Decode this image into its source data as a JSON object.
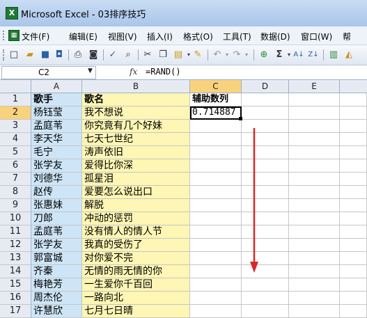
{
  "window": {
    "title": "Microsoft Excel - 03排序技巧",
    "app_icon_glyph": "X"
  },
  "menu": {
    "items": [
      "文件(F)",
      "编辑(E)",
      "视图(V)",
      "插入(I)",
      "格式(O)",
      "工具(T)",
      "数据(D)",
      "窗口(W)",
      "帮"
    ]
  },
  "formula_bar": {
    "name_box": "C2",
    "fx": "fx",
    "formula": "=RAND()"
  },
  "columns": [
    "A",
    "B",
    "C",
    "D",
    "E"
  ],
  "rows": [
    {
      "num": "1",
      "a": "歌手",
      "b": "歌名",
      "c": "辅助数列"
    },
    {
      "num": "2",
      "a": "杨钰莹",
      "b": "我不想说",
      "c": "0.714887"
    },
    {
      "num": "3",
      "a": "孟庭苇",
      "b": "你究竟有几个好妹",
      "c": ""
    },
    {
      "num": "4",
      "a": "李天华",
      "b": "七天七世纪",
      "c": ""
    },
    {
      "num": "5",
      "a": "毛宁",
      "b": "涛声依旧",
      "c": ""
    },
    {
      "num": "6",
      "a": "张学友",
      "b": "爱得比你深",
      "c": ""
    },
    {
      "num": "7",
      "a": "刘德华",
      "b": "孤星泪",
      "c": ""
    },
    {
      "num": "8",
      "a": "赵传",
      "b": "爱要怎么说出口",
      "c": ""
    },
    {
      "num": "9",
      "a": "张惠妹",
      "b": "解脱",
      "c": ""
    },
    {
      "num": "10",
      "a": "刀郎",
      "b": "冲动的惩罚",
      "c": ""
    },
    {
      "num": "11",
      "a": "孟庭苇",
      "b": "没有情人的情人节",
      "c": ""
    },
    {
      "num": "12",
      "a": "张学友",
      "b": "我真的受伤了",
      "c": ""
    },
    {
      "num": "13",
      "a": "郭富城",
      "b": "对你爱不完",
      "c": ""
    },
    {
      "num": "14",
      "a": "齐秦",
      "b": "无情的雨无情的你",
      "c": ""
    },
    {
      "num": "15",
      "a": "梅艳芳",
      "b": "一生爱你千百回",
      "c": ""
    },
    {
      "num": "16",
      "a": "周杰伦",
      "b": "一路向北",
      "c": ""
    },
    {
      "num": "17",
      "a": "许慧欣",
      "b": "七月七日晴",
      "c": ""
    }
  ],
  "selection": {
    "cell": "C2",
    "active_column": "C",
    "active_row": "2"
  },
  "annotation": {
    "type": "down-arrow",
    "color": "#d9262b"
  },
  "colors": {
    "column_a_fill": "#cde5f7",
    "column_b_fill": "#fdf6b4",
    "header_active": "#f8d27c"
  }
}
